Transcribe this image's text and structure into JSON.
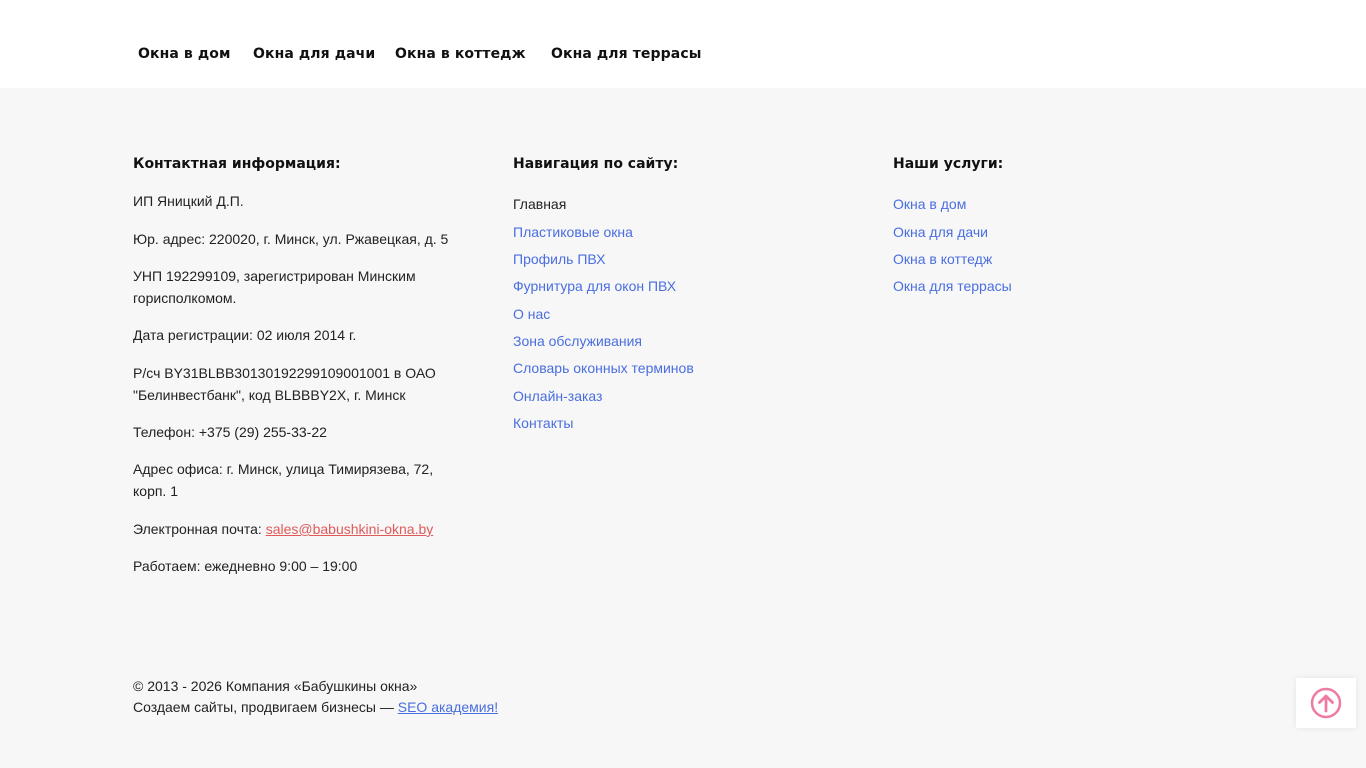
{
  "top_nav": {
    "items": [
      "Окна в дом",
      "Окна для дачи",
      "Окна в коттедж",
      "Окна для террасы"
    ]
  },
  "contact": {
    "heading": "Контактная информация:",
    "company": "ИП Яницкий Д.П.",
    "legal_address": "Юр. адрес: 220020, г. Минск, ул. Ржавецкая, д. 5",
    "unp": "УНП 192299109, зарегистрирован Минским горисполкомом.",
    "registration_date": "Дата регистрации: 02 июля 2014 г.",
    "bank_account": "Р/сч BY31BLBB30130192299109001001 в ОАО \"Белинвестбанк\", код BLBBBY2X, г. Минск",
    "phone": "Телефон: +375 (29) 255-33-22",
    "office_address": "Адрес офиса: г. Минск, улица Тимирязева, 72, корп. 1",
    "email_label": "Электронная почта: ",
    "email": "sales@babushkini-okna.by",
    "hours": "Работаем: ежедневно 9:00 – 19:00"
  },
  "site_nav": {
    "heading": "Навигация по сайту:",
    "items": [
      "Главная",
      "Пластиковые окна",
      "Профиль ПВХ",
      "Фурнитура для окон ПВХ",
      "О нас",
      "Зона обслуживания",
      "Словарь оконных терминов",
      "Онлайн-заказ",
      "Контакты"
    ]
  },
  "services": {
    "heading": "Наши услуги:",
    "items": [
      "Окна в дом",
      "Окна для дачи",
      "Окна в коттедж",
      "Окна для террасы"
    ]
  },
  "footer": {
    "copyright": "© 2013 - 2026 Компания «Бабушкины окна»",
    "credit_text": "Создаем сайты, продвигаем бизнесы — ",
    "credit_link": "SEO академия!"
  },
  "colors": {
    "link": "#4a6ee0",
    "email_link": "#e05a5a",
    "to_top_icon": "#f07aa0"
  },
  "icons": {
    "to_top": "arrow-up-circle-icon"
  }
}
